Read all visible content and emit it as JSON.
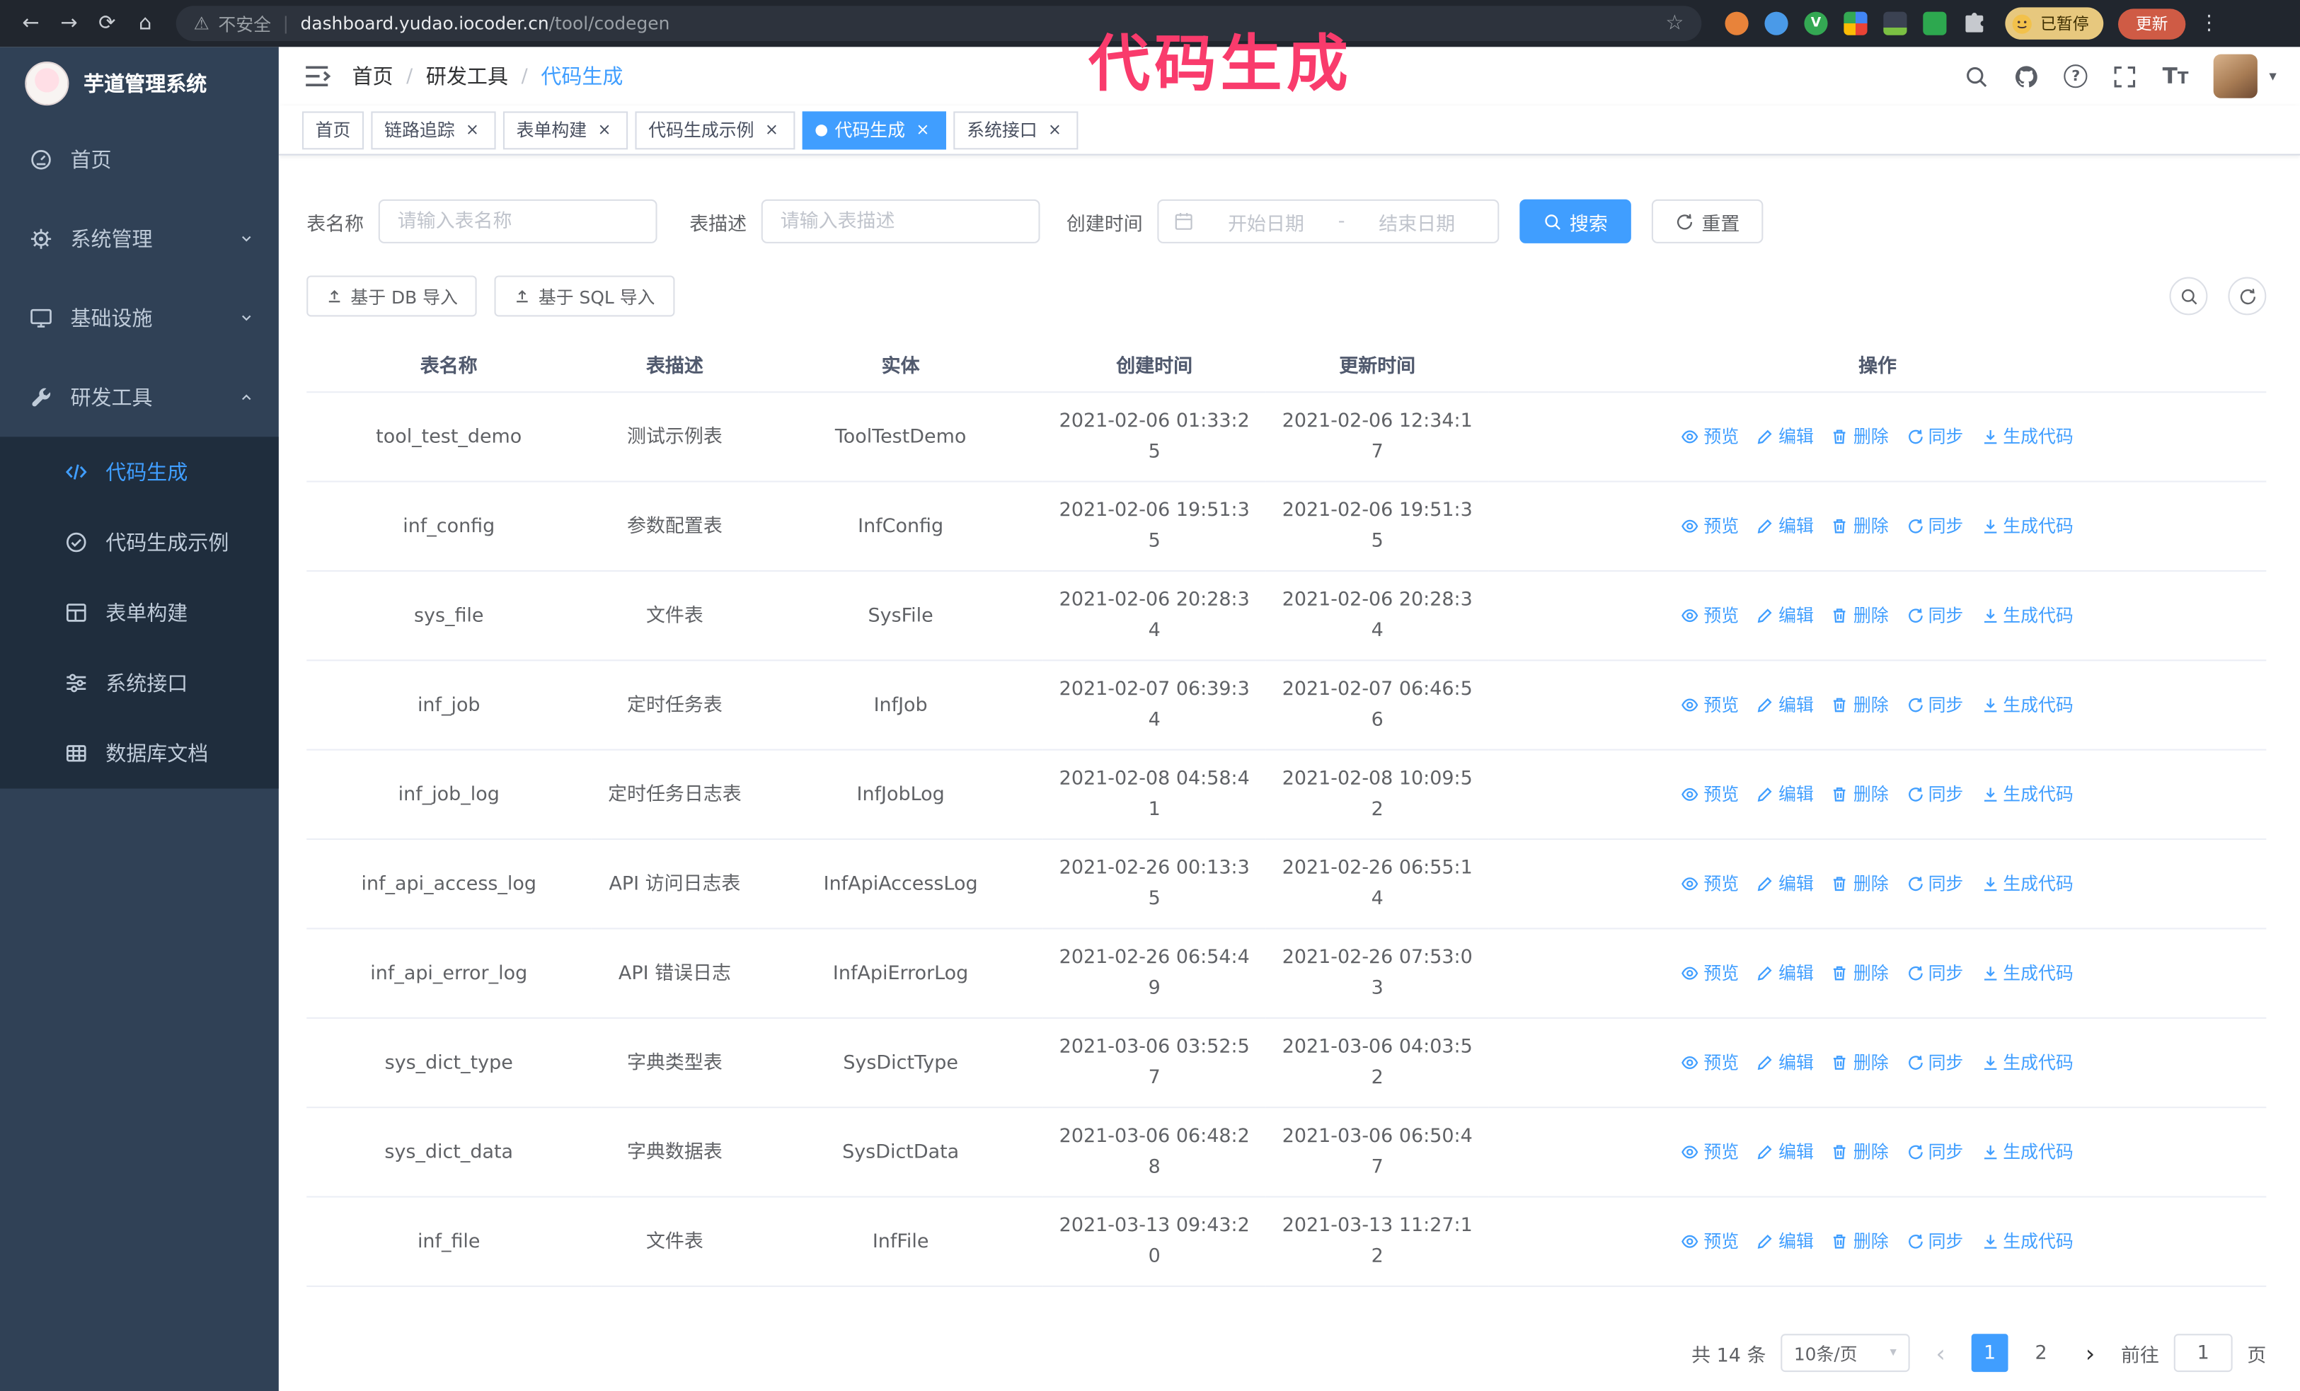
{
  "browser": {
    "security_label": "不安全",
    "url_host": "dashboard.yudao.iocoder.cn",
    "url_path": "/tool/codegen",
    "profile_badge_label": "已暂停",
    "update_label": "更新"
  },
  "annotation": {
    "text": "代码生成"
  },
  "sidebar": {
    "title": "芋道管理系统",
    "items": [
      {
        "label": "首页"
      },
      {
        "label": "系统管理"
      },
      {
        "label": "基础设施"
      },
      {
        "label": "研发工具"
      }
    ],
    "submenu": [
      {
        "label": "代码生成",
        "active": true
      },
      {
        "label": "代码生成示例"
      },
      {
        "label": "表单构建"
      },
      {
        "label": "系统接口"
      },
      {
        "label": "数据库文档"
      }
    ]
  },
  "breadcrumb": {
    "items": [
      "首页",
      "研发工具",
      "代码生成"
    ]
  },
  "tabs": [
    {
      "label": "首页",
      "closable": false
    },
    {
      "label": "链路追踪",
      "closable": true
    },
    {
      "label": "表单构建",
      "closable": true
    },
    {
      "label": "代码生成示例",
      "closable": true
    },
    {
      "label": "代码生成",
      "closable": true,
      "active": true
    },
    {
      "label": "系统接口",
      "closable": true
    }
  ],
  "filters": {
    "table_name_label": "表名称",
    "table_name_placeholder": "请输入表名称",
    "table_desc_label": "表描述",
    "table_desc_placeholder": "请输入表描述",
    "create_time_label": "创建时间",
    "date_start_placeholder": "开始日期",
    "date_range_separator": "-",
    "date_end_placeholder": "结束日期",
    "search_label": "搜索",
    "reset_label": "重置"
  },
  "toolbar": {
    "import_db_label": "基于 DB 导入",
    "import_sql_label": "基于 SQL 导入"
  },
  "table": {
    "columns": [
      "表名称",
      "表描述",
      "实体",
      "创建时间",
      "更新时间",
      "操作"
    ],
    "action_labels": [
      "预览",
      "编辑",
      "删除",
      "同步",
      "生成代码"
    ],
    "rows": [
      {
        "name": "tool_test_demo",
        "desc": "测试示例表",
        "entity": "ToolTestDemo",
        "created": "2021-02-06 01:33:25",
        "updated": "2021-02-06 12:34:17"
      },
      {
        "name": "inf_config",
        "desc": "参数配置表",
        "entity": "InfConfig",
        "created": "2021-02-06 19:51:35",
        "updated": "2021-02-06 19:51:35"
      },
      {
        "name": "sys_file",
        "desc": "文件表",
        "entity": "SysFile",
        "created": "2021-02-06 20:28:34",
        "updated": "2021-02-06 20:28:34"
      },
      {
        "name": "inf_job",
        "desc": "定时任务表",
        "entity": "InfJob",
        "created": "2021-02-07 06:39:34",
        "updated": "2021-02-07 06:46:56"
      },
      {
        "name": "inf_job_log",
        "desc": "定时任务日志表",
        "entity": "InfJobLog",
        "created": "2021-02-08 04:58:41",
        "updated": "2021-02-08 10:09:52"
      },
      {
        "name": "inf_api_access_log",
        "desc": "API 访问日志表",
        "entity": "InfApiAccessLog",
        "created": "2021-02-26 00:13:35",
        "updated": "2021-02-26 06:55:14"
      },
      {
        "name": "inf_api_error_log",
        "desc": "API 错误日志",
        "entity": "InfApiErrorLog",
        "created": "2021-02-26 06:54:49",
        "updated": "2021-02-26 07:53:03"
      },
      {
        "name": "sys_dict_type",
        "desc": "字典类型表",
        "entity": "SysDictType",
        "created": "2021-03-06 03:52:57",
        "updated": "2021-03-06 04:03:52"
      },
      {
        "name": "sys_dict_data",
        "desc": "字典数据表",
        "entity": "SysDictData",
        "created": "2021-03-06 06:48:28",
        "updated": "2021-03-06 06:50:47"
      },
      {
        "name": "inf_file",
        "desc": "文件表",
        "entity": "InfFile",
        "created": "2021-03-13 09:43:20",
        "updated": "2021-03-13 11:27:12"
      }
    ]
  },
  "pagination": {
    "total_label": "共 14 条",
    "page_size_label": "10条/页",
    "pages": [
      "1",
      "2"
    ],
    "active_page": "1",
    "goto_label": "前往",
    "goto_value": "1",
    "goto_unit": "页"
  },
  "icons": {
    "back": "←",
    "forward": "→",
    "reload": "⟳",
    "home": "⌂",
    "warning": "⚠",
    "separator": "|",
    "star": "☆",
    "kebab": "⋮",
    "close": "×",
    "caret_down": "▾",
    "breadcrumb_separator": "/",
    "prev": "‹",
    "next": "›",
    "extension_v_letter": "V",
    "help": "?",
    "font_size_big": "T",
    "font_size_small": "T"
  },
  "colors": {
    "accent": "#409eff",
    "sidebar_bg": "#304156",
    "submenu_bg": "#1f2d3d",
    "annotation": "#f93b6c",
    "tab_active_bg": "#409eff",
    "update_button_bg": "#cf5b45",
    "profile_badge_bg": "#e7c87e"
  }
}
